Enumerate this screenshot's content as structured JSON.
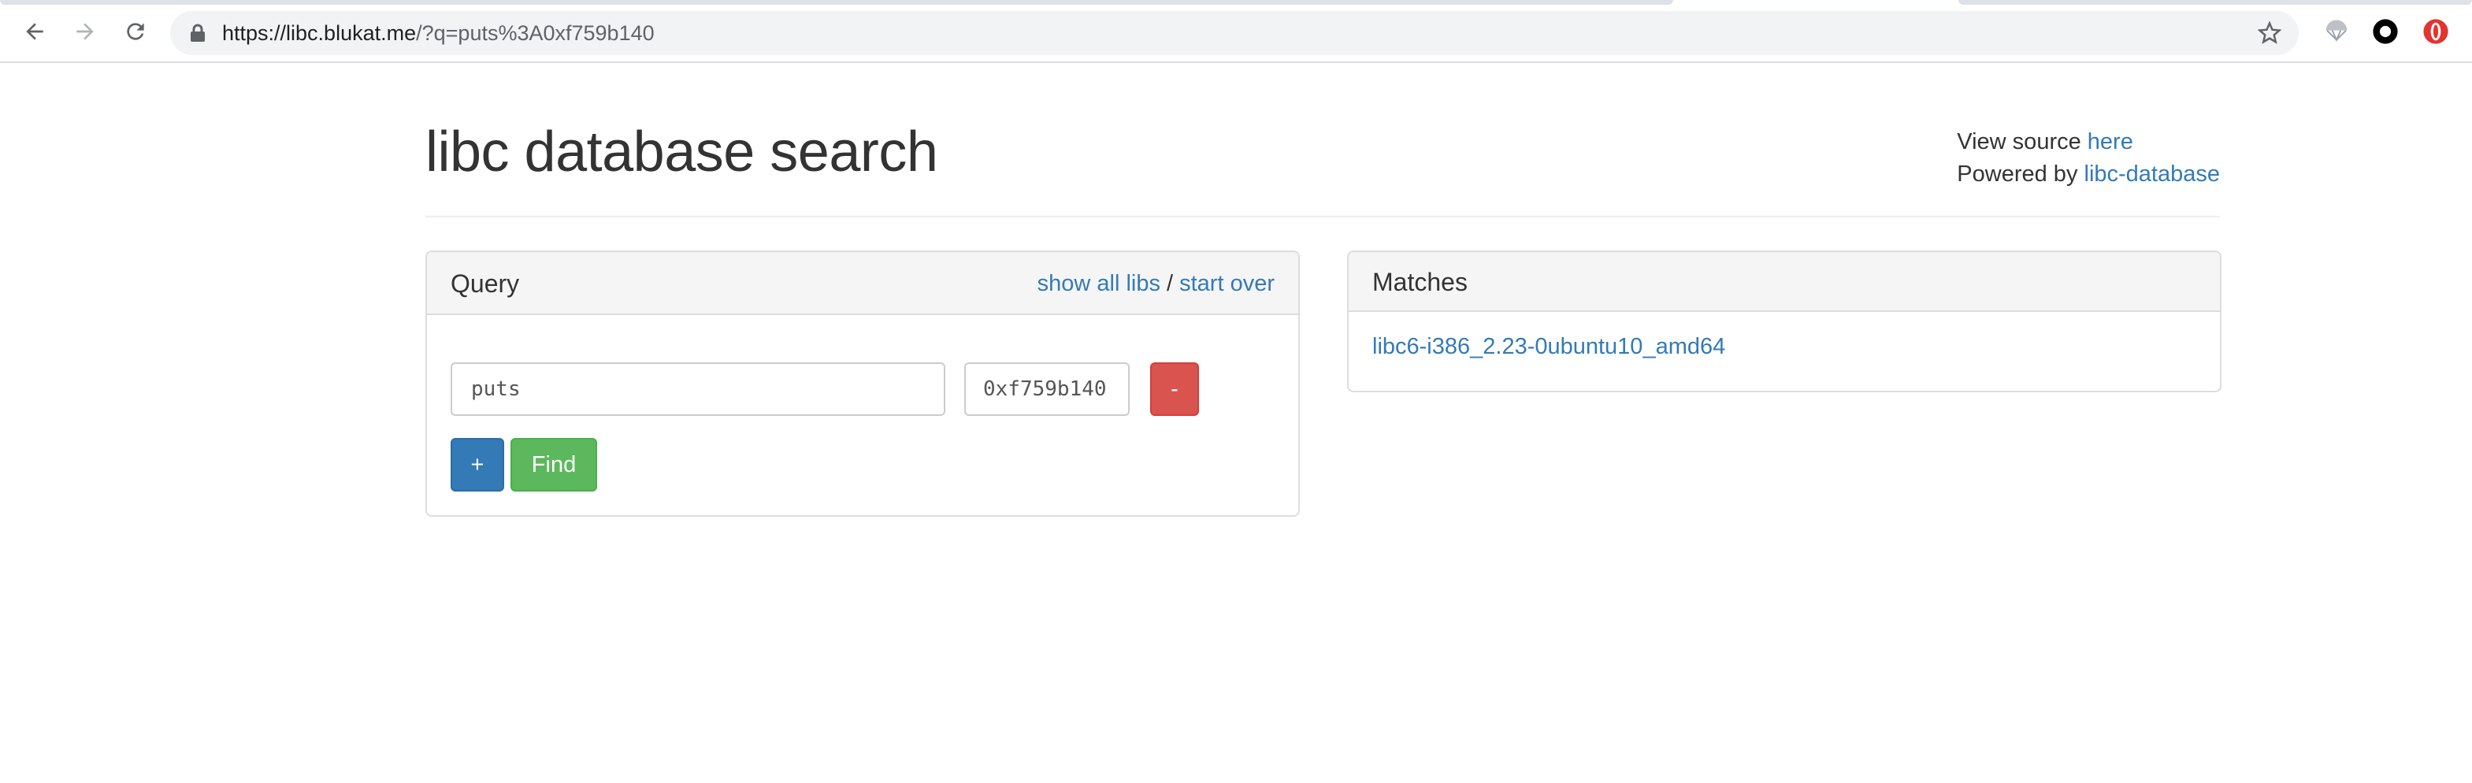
{
  "browser": {
    "url_host": "https://libc.blukat.me",
    "url_rest": "/?q=puts%3A0xf759b140",
    "icons": [
      "back-arrow-icon",
      "forward-arrow-icon",
      "reload-icon",
      "lock-icon",
      "star-icon",
      "parachute-extension-icon",
      "circle-extension-icon",
      "opera-extension-icon"
    ]
  },
  "header": {
    "title": "libc database search",
    "view_source_prefix": "View source ",
    "view_source_link": "here",
    "powered_prefix": "Powered by ",
    "powered_link": "libc-database"
  },
  "query": {
    "title": "Query",
    "show_all_libs": "show all libs",
    "separator": " / ",
    "start_over": "start over",
    "symbol_value": "puts",
    "address_value": "0xf759b140",
    "remove_label": "-",
    "add_label": "+",
    "find_label": "Find"
  },
  "matches": {
    "title": "Matches",
    "items": [
      "libc6-i386_2.23-0ubuntu10_amd64"
    ]
  },
  "colors": {
    "link": "#337ab7",
    "danger": "#d9534f",
    "primary": "#337ab7",
    "success": "#5cb85c"
  }
}
